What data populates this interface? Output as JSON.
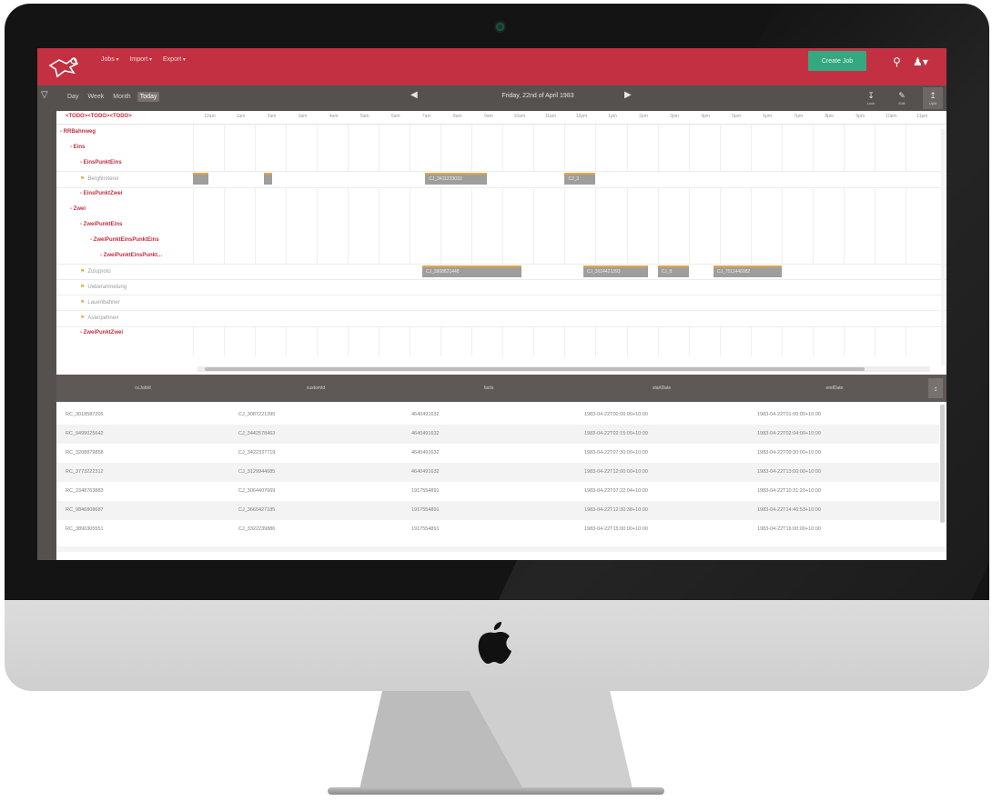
{
  "app": {
    "menu": [
      "Jobs",
      "Import",
      "Export"
    ],
    "create_button": "Create Job",
    "search_icon": "search-icon",
    "user_icon": "user-icon"
  },
  "toolbar": {
    "views": [
      "Day",
      "Week",
      "Month",
      "Today"
    ],
    "active_view": "Today",
    "date_title": "Friday, 22nd of April 1983",
    "tools": [
      {
        "icon": "download-icon",
        "label": "Lock"
      },
      {
        "icon": "edit-icon",
        "label": "Edit"
      },
      {
        "icon": "upload-icon",
        "label": "Upld"
      }
    ]
  },
  "scheduler": {
    "title": "<TODO><TODO><TODO>",
    "hours": [
      "12am",
      "1am",
      "2am",
      "3am",
      "4am",
      "5am",
      "6am",
      "7am",
      "8am",
      "9am",
      "10am",
      "11am",
      "12pm",
      "1pm",
      "2pm",
      "3pm",
      "4pm",
      "5pm",
      "6pm",
      "7pm",
      "8pm",
      "9pm",
      "10pm",
      "11pm"
    ],
    "rows": [
      {
        "type": "group",
        "level": 0,
        "label": "- RRBahnweg"
      },
      {
        "type": "group",
        "level": 1,
        "label": "- Eins"
      },
      {
        "type": "group",
        "level": 2,
        "label": "- EinsPunktEins"
      },
      {
        "type": "resource",
        "level": 2,
        "label": "Bergfinsterer"
      },
      {
        "type": "group",
        "level": 2,
        "label": "- EinsPunktZwei"
      },
      {
        "type": "group",
        "level": 1,
        "label": "- Zwei"
      },
      {
        "type": "group",
        "level": 2,
        "label": "- ZweiPunktEins"
      },
      {
        "type": "group",
        "level": 3,
        "label": "- ZweiPunktEinsPunktEins"
      },
      {
        "type": "group",
        "level": 4,
        "label": "- ZweiPunktEinsPunkt..."
      },
      {
        "type": "resource",
        "level": 2,
        "label": "Zuluproto"
      },
      {
        "type": "resource",
        "level": 2,
        "label": "Ueberanmelung"
      },
      {
        "type": "resource",
        "level": 2,
        "label": "Lauenbahner"
      },
      {
        "type": "resource",
        "level": 2,
        "label": "Asterpehnen"
      },
      {
        "type": "group",
        "level": 2,
        "label": "- ZweiPunktZwei"
      }
    ],
    "events": [
      {
        "row": 3,
        "label": "",
        "start": 0.0,
        "end": 0.5
      },
      {
        "row": 3,
        "label": "",
        "start": 2.3,
        "end": 2.55
      },
      {
        "row": 3,
        "label": "CJ_3411223033",
        "start": 7.5,
        "end": 9.5
      },
      {
        "row": 3,
        "label": "CJ_3",
        "start": 12.0,
        "end": 13.0
      },
      {
        "row": 9,
        "label": "CJ_3908821448",
        "start": 7.4,
        "end": 10.6
      },
      {
        "row": 9,
        "label": "CJ_3624421393",
        "start": 12.6,
        "end": 14.7
      },
      {
        "row": 9,
        "label": "CJ_8",
        "start": 15.0,
        "end": 16.0
      },
      {
        "row": 9,
        "label": "CJ_7511446082",
        "start": 16.8,
        "end": 19.0
      }
    ]
  },
  "table": {
    "headers": [
      "ccJobId",
      "customId",
      "facts",
      "startDate",
      "endDate"
    ],
    "rows": [
      [
        "RC_3018587205",
        "CJ_3087221395",
        "4640491632",
        "1983-04-22T00:00:00+10:00",
        "1983-04-22T01:00:00+10:00"
      ],
      [
        "RC_9499025642",
        "CJ_3442578463",
        "4640491632",
        "1983-04-22T02:15:00+10:00",
        "1983-04-22T02:04:00+10:00"
      ],
      [
        "RC_3208879858",
        "CJ_3422337719",
        "4640491632",
        "1983-04-22T07:30:00+10:00",
        "1983-04-22T09:30:00+10:00"
      ],
      [
        "RC_3773222312",
        "CJ_3129944685",
        "4640491632",
        "1983-04-22T12:00:00+10:00",
        "1983-04-22T13:00:00+10:00"
      ],
      [
        "RC_2348763883",
        "CJ_3064407669",
        "1917554891",
        "1983-04-22T07:22:04+10:00",
        "1983-04-22T10:31:20+10:00"
      ],
      [
        "RC_9846808687",
        "CJ_3665427185",
        "1917554891",
        "1983-04-22T12:30:38+10:00",
        "1983-04-22T14:46:53+10:00"
      ],
      [
        "RC_3890305551",
        "CJ_3322239886",
        "1917554891",
        "1983-04-22T15:00:00+10:00",
        "1983-04-22T16:00:00+10:00"
      ]
    ]
  }
}
